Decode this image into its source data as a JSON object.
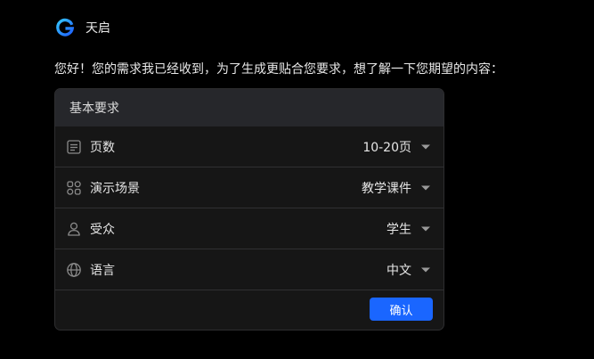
{
  "header": {
    "brand_name": "天启",
    "logo_icon": "brand-g-logo-icon"
  },
  "message": {
    "greeting": "您好！您的需求我已经收到，为了生成更贴合您要求，想了解一下您期望的内容："
  },
  "form": {
    "title": "基本要求",
    "rows": [
      {
        "icon": "document-icon",
        "label": "页数",
        "value": "10-20页"
      },
      {
        "icon": "grid-icon",
        "label": "演示场景",
        "value": "教学课件"
      },
      {
        "icon": "user-icon",
        "label": "受众",
        "value": "学生"
      },
      {
        "icon": "globe-icon",
        "label": "语言",
        "value": "中文"
      }
    ],
    "confirm_label": "确认"
  },
  "colors": {
    "accent": "#1a66ff",
    "background": "#000000",
    "card": "#161616",
    "card_header": "#26272b"
  }
}
